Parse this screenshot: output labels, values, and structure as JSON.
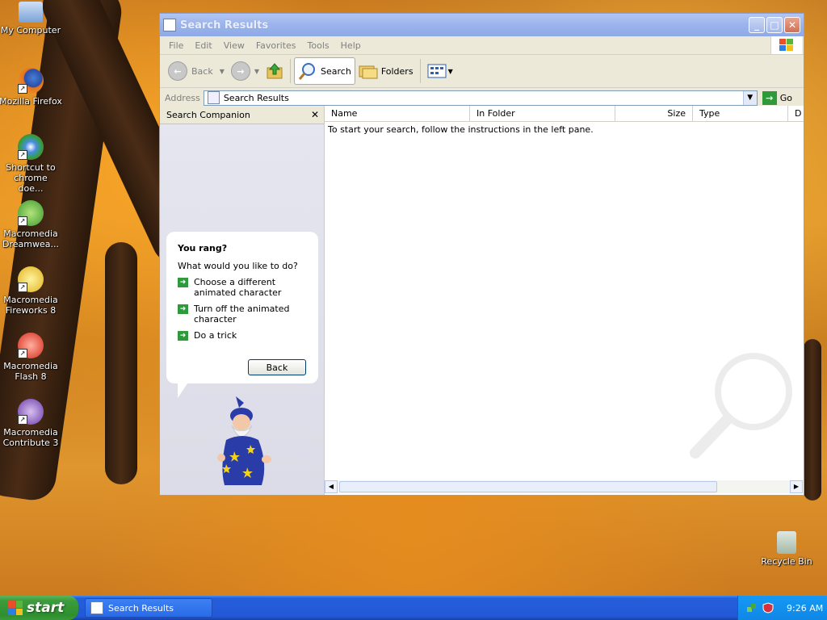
{
  "desktop": {
    "icons": [
      {
        "label": "My Computer",
        "icon": "my-computer-icon"
      },
      {
        "label": "Mozilla Firefox",
        "icon": "firefox-icon"
      },
      {
        "label": "Shortcut to chrome doe...",
        "icon": "chrome-shortcut-icon"
      },
      {
        "label": "Macromedia Dreamwea...",
        "icon": "dreamweaver-icon"
      },
      {
        "label": "Macromedia Fireworks 8",
        "icon": "fireworks-icon"
      },
      {
        "label": "Macromedia Flash 8",
        "icon": "flash-icon"
      },
      {
        "label": "Macromedia Contribute 3",
        "icon": "contribute-icon"
      }
    ],
    "recycle_bin": {
      "label": "Recycle Bin",
      "icon": "recycle-bin-icon"
    }
  },
  "window": {
    "title": "Search Results",
    "menu": [
      "File",
      "Edit",
      "View",
      "Favorites",
      "Tools",
      "Help"
    ],
    "toolbar": {
      "back": "Back",
      "search": "Search",
      "folders": "Folders"
    },
    "address": {
      "label": "Address",
      "value": "Search Results",
      "go": "Go"
    },
    "companion": {
      "title": "Search Companion",
      "close": "✕",
      "bubble_title": "You rang?",
      "bubble_question": "What would you like to do?",
      "options": [
        "Choose a different animated character",
        "Turn off the animated character",
        "Do a trick"
      ],
      "back_button": "Back"
    },
    "results": {
      "columns": [
        "Name",
        "In Folder",
        "Size",
        "Type",
        "D"
      ],
      "message": "To start your search, follow the instructions in the left pane."
    }
  },
  "taskbar": {
    "start": "start",
    "items": [
      "Search Results"
    ],
    "clock": "9:26 AM"
  },
  "colors": {
    "taskbar_blue": "#245edb",
    "start_green": "#3c9d3c",
    "title_inactive": "#9db5ec"
  }
}
